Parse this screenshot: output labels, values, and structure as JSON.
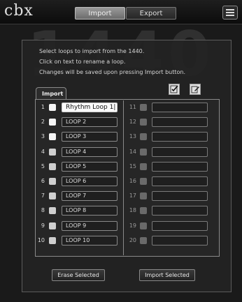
{
  "app": {
    "logo": "cbx"
  },
  "tabs": {
    "import": "Import",
    "export": "Export"
  },
  "background_text": "1440",
  "instructions": [
    "Select loops to import from the 1440.",
    "Click on text to rename a loop.",
    "Changes will be saved upon pressing Import button."
  ],
  "section_tab": "Import",
  "loops_left": [
    {
      "num": "1",
      "name": "Rhythm Loop 1|"
    },
    {
      "num": "2",
      "name": "LOOP 2"
    },
    {
      "num": "3",
      "name": "LOOP 3"
    },
    {
      "num": "4",
      "name": "LOOP 4"
    },
    {
      "num": "5",
      "name": "LOOP 5"
    },
    {
      "num": "6",
      "name": "LOOP 6"
    },
    {
      "num": "7",
      "name": "LOOP 7"
    },
    {
      "num": "8",
      "name": "LOOP 8"
    },
    {
      "num": "9",
      "name": "LOOP 9"
    },
    {
      "num": "10",
      "name": "LOOP 10"
    }
  ],
  "loops_right": [
    {
      "num": "11",
      "name": ""
    },
    {
      "num": "12",
      "name": ""
    },
    {
      "num": "13",
      "name": ""
    },
    {
      "num": "14",
      "name": ""
    },
    {
      "num": "15",
      "name": ""
    },
    {
      "num": "16",
      "name": ""
    },
    {
      "num": "17",
      "name": ""
    },
    {
      "num": "18",
      "name": ""
    },
    {
      "num": "19",
      "name": ""
    },
    {
      "num": "20",
      "name": ""
    }
  ],
  "buttons": {
    "erase": "Erase Selected",
    "import": "Import Selected"
  },
  "icons": {
    "select_all": "select-all-icon",
    "edit": "edit-icon",
    "menu": "hamburger-menu-icon"
  }
}
